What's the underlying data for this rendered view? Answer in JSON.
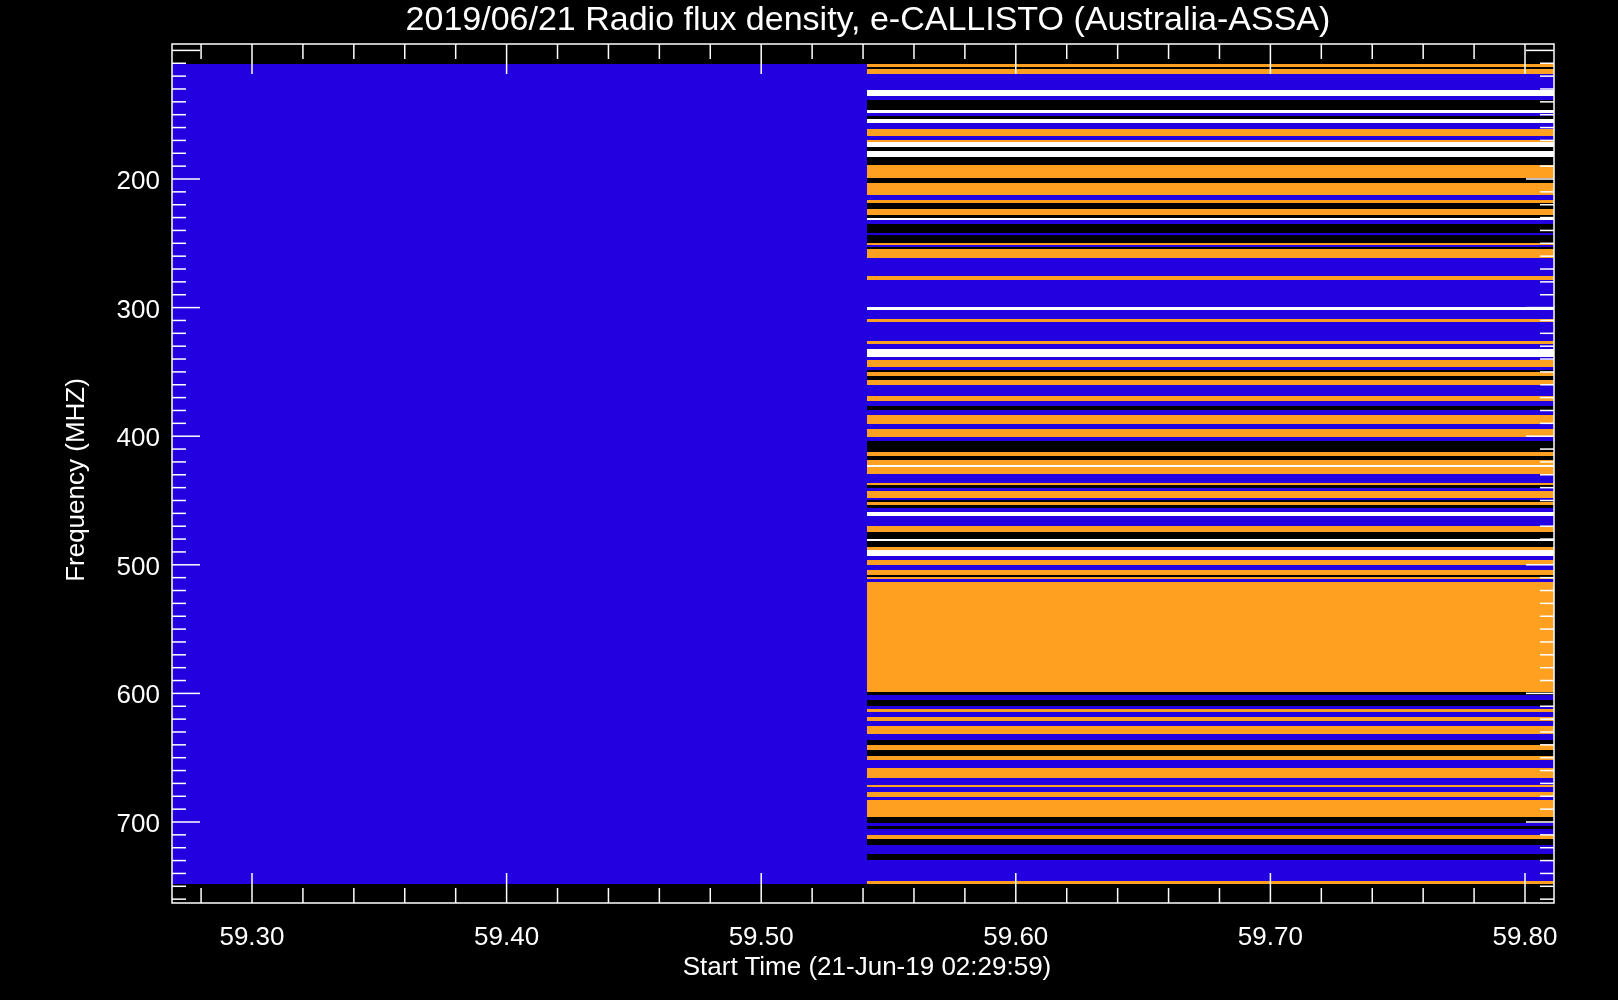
{
  "title": "2019/06/21  Radio flux density, e-CALLISTO (Australia-ASSA)",
  "y_axis": {
    "label": "Frequency (MHZ)",
    "tick_labels": [
      "200",
      "300",
      "400",
      "500",
      "600",
      "700"
    ]
  },
  "x_axis": {
    "label": "Start Time (21-Jun-19 02:29:59)",
    "tick_labels": [
      "59.30",
      "59.40",
      "59.50",
      "59.60",
      "59.70",
      "59.80"
    ]
  }
}
